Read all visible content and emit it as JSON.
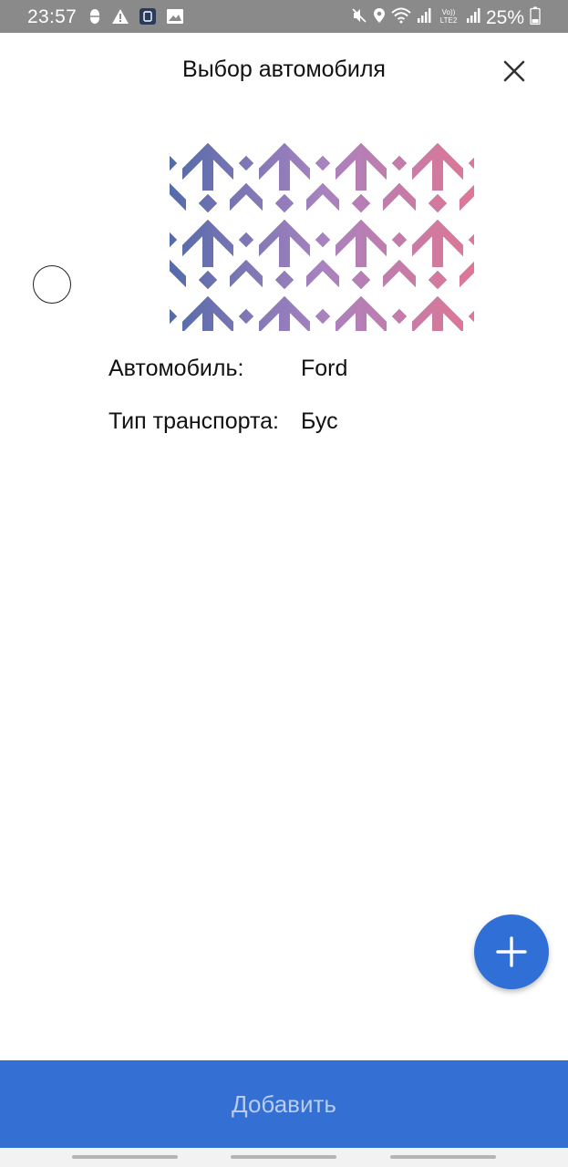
{
  "status_bar": {
    "time": "23:57",
    "battery": "25%",
    "left_icons": [
      "usb-debug-icon",
      "warning-icon",
      "app-notification-icon",
      "image-icon"
    ],
    "right_icons": [
      "mute-icon",
      "location-icon",
      "wifi-icon",
      "signal-icon",
      "volte-icon",
      "signal-icon",
      "battery-icon"
    ]
  },
  "header": {
    "title": "Выбор автомобиля",
    "close_icon": "close-icon"
  },
  "vehicle": {
    "selected": false,
    "car_label": "Автомобиль:",
    "car_value": "Ford",
    "type_label": "Тип транспорта:",
    "type_value": "Бус"
  },
  "fab": {
    "icon": "plus-icon"
  },
  "footer": {
    "add_label": "Добавить"
  },
  "colors": {
    "accent": "#3470d4",
    "fab": "#2f6fd6",
    "status_bar": "#8a8a8a",
    "disabled_text": "#b9ccee"
  }
}
